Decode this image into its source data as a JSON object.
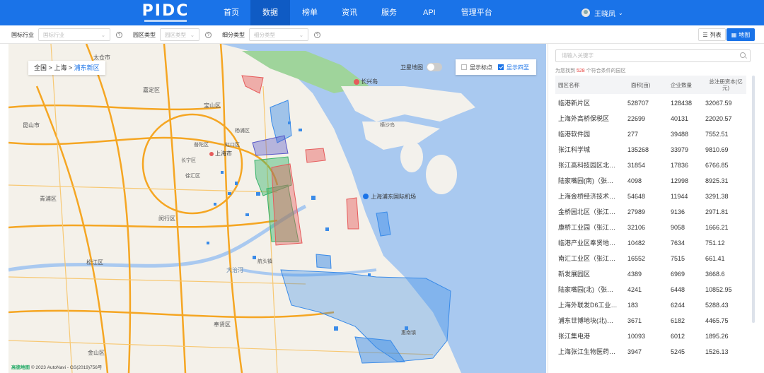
{
  "header": {
    "logo_text": "PIDC",
    "nav": [
      "首页",
      "数据",
      "榜单",
      "资讯",
      "服务",
      "API",
      "管理平台"
    ],
    "active_nav": "数据",
    "user_name": "王晓凤"
  },
  "filters": {
    "industry_label": "国标行业",
    "industry_placeholder": "国标行业",
    "park_type_label": "园区类型",
    "park_type_placeholder": "园区类型",
    "subtype_label": "细分类型",
    "subtype_placeholder": "细分类型",
    "list_button": "列表",
    "map_button": "地图"
  },
  "map": {
    "breadcrumb": {
      "root": "全国",
      "sep1": ">",
      "city": "上海",
      "sep2": ">",
      "district": "浦东新区"
    },
    "satellite_label": "卫星地图",
    "show_points_label": "显示标点",
    "show_boundary_label": "显示四至",
    "labels": {
      "changxing_island": "长兴岛",
      "hengsha_island": "横沙岛",
      "shanghai_city": "上海市",
      "pudong_airport": "上海浦东国际机场",
      "dazhihe": "大治河",
      "hangtou": "航头镇",
      "huinan": "惠南镇",
      "songjiang": "松江区",
      "qingpu": "青浦区",
      "minhang": "闵行区",
      "jiading": "嘉定区",
      "baoshan": "宝山区",
      "fengxian": "奉贤区",
      "jinshan": "金山区",
      "xuhui": "徐汇区",
      "changning": "长宁区",
      "putuo": "普陀区",
      "yangpu": "杨浦区",
      "hongkou": "虹口区",
      "kunshan": "昆山市",
      "taicang": "太仓市"
    },
    "attribution_brand": "高德地图",
    "attribution_text": "© 2023 AutoNavi - GS(2019)756号"
  },
  "panel": {
    "search_placeholder": "请输入关键字",
    "summary_prefix": "为您找到",
    "summary_count": "528",
    "summary_suffix": "个符合条件的园区",
    "columns": [
      "园区名称",
      "面积(亩)",
      "企业数量",
      "总注册资本(亿元)"
    ],
    "rows": [
      [
        "临港新片区",
        "528707",
        "128438",
        "32067.59"
      ],
      [
        "上海外高桥保税区",
        "22699",
        "40131",
        "22020.57"
      ],
      [
        "临港软件园",
        "277",
        "39488",
        "7552.51"
      ],
      [
        "张江科学城",
        "135268",
        "33979",
        "9810.69"
      ],
      [
        "张江高科技园区北…",
        "31854",
        "17836",
        "6766.85"
      ],
      [
        "陆家嘴园(南)（张…",
        "4098",
        "12998",
        "8925.31"
      ],
      [
        "上海金桥经济技术…",
        "54648",
        "11944",
        "3291.38"
      ],
      [
        "金桥园北区（张江…",
        "27989",
        "9136",
        "2971.81"
      ],
      [
        "康桥工业园（张江…",
        "32106",
        "9058",
        "1666.21"
      ],
      [
        "临港产业区奉贤地…",
        "10482",
        "7634",
        "751.12"
      ],
      [
        "南汇工业区（张江…",
        "16552",
        "7515",
        "661.41"
      ],
      [
        "新发展园区",
        "4389",
        "6969",
        "3668.6"
      ],
      [
        "陆家嘴园(北)（张…",
        "4241",
        "6448",
        "10852.95"
      ],
      [
        "上海外联发D6工业…",
        "183",
        "6244",
        "5288.43"
      ],
      [
        "浦东世博地块(北)…",
        "3671",
        "6182",
        "4465.75"
      ],
      [
        "张江集电港",
        "10093",
        "6012",
        "1895.26"
      ],
      [
        "上海张江生物医药…",
        "3947",
        "5245",
        "1526.13"
      ]
    ]
  },
  "colors": {
    "primary": "#1a73e8",
    "nav_active": "#0f5bc4",
    "count_red": "#e53935",
    "water": "#a9c9f0",
    "park_green": "#37b36a",
    "park_red": "#e65b5b",
    "park_blue": "#3a8be8"
  }
}
